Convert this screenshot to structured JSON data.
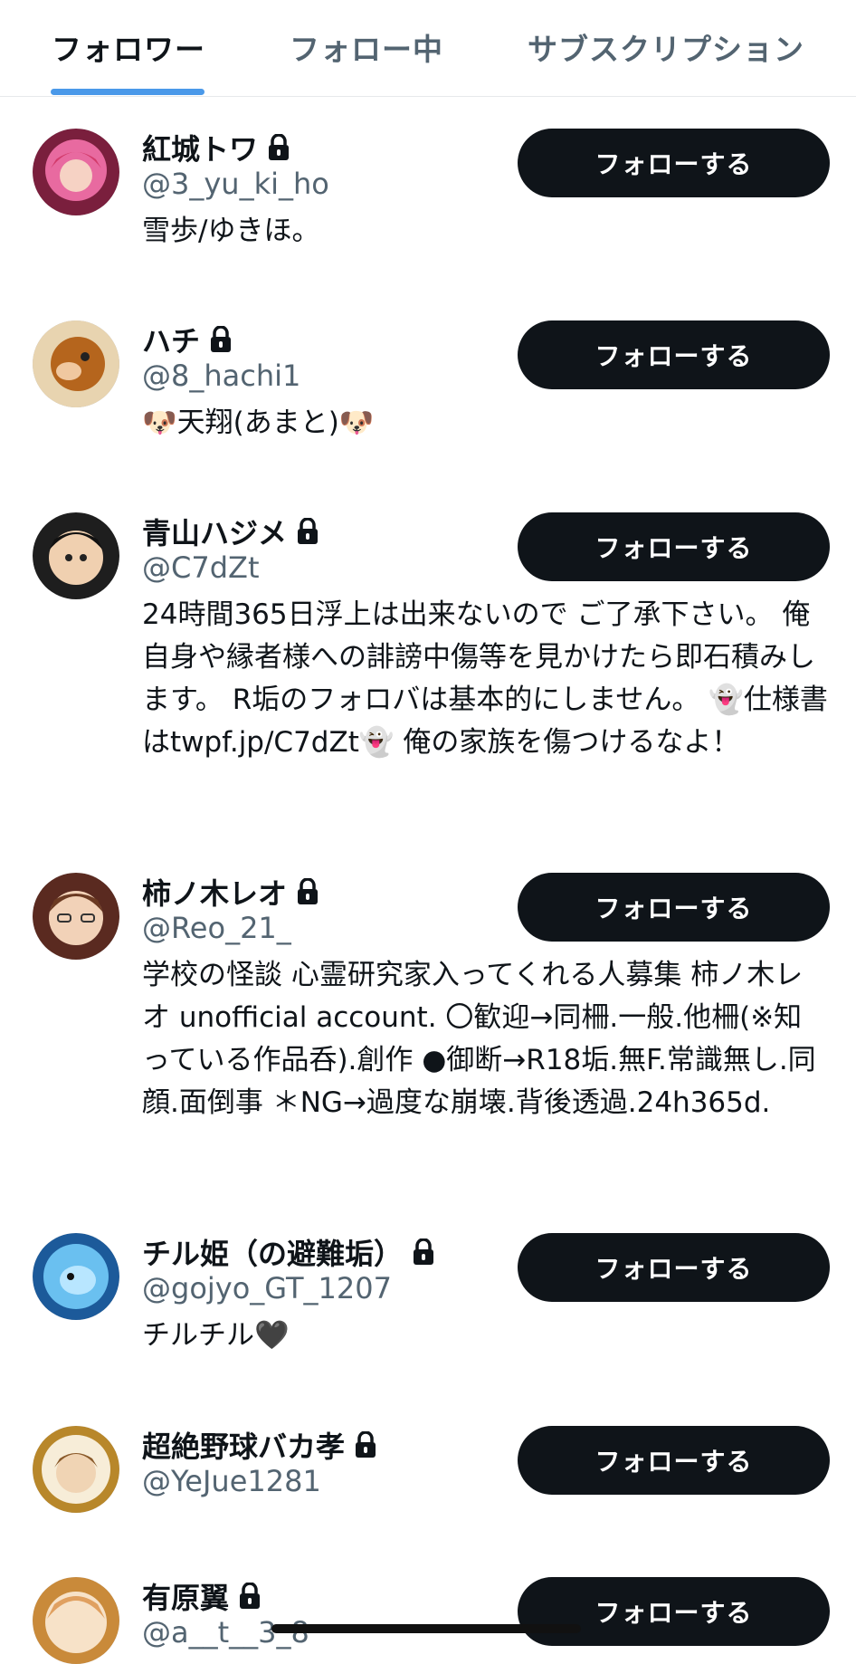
{
  "tabs": [
    {
      "label": "フォロワー",
      "active": true
    },
    {
      "label": "フォロー中",
      "active": false
    },
    {
      "label": "サブスクリプション",
      "active": false
    }
  ],
  "follow_label": "フォローする",
  "accent_color": "#4a99e9",
  "users": [
    {
      "name": "紅城トワ",
      "handle": "@3_yu_ki_ho",
      "bio": "雪歩/ゆきほ。",
      "protected": true,
      "avatar_color": "#d23a6a"
    },
    {
      "name": "ハチ",
      "handle": "@8_hachi1",
      "bio": "🐶天翔(あまと)🐶",
      "protected": true,
      "avatar_color": "#b5651d"
    },
    {
      "name": "青山ハジメ",
      "handle": "@C7dZt",
      "bio": "24時間365日浮上は出来ないので ご了承下さい。 俺自身や縁者様への誹謗中傷等を見かけたら即石積みします。 R垢のフォロバは基本的にしません。 👻仕様書はtwpf.jp/C7dZt👻 俺の家族を傷つけるなよ！",
      "protected": true,
      "avatar_color": "#2b2b2b"
    },
    {
      "name": "柿ノ木レオ",
      "handle": "@Reo_21_",
      "bio": "学校の怪談 心霊研究家入ってくれる人募集 柿ノ木レオ unofficial account. 〇歓迎→同柵.一般.他柵(※知っている作品呑).創作 ●御断→R18垢.無F.常識無し.同顔.面倒事 ＊NG→過度な崩壊.背後透過.24h365d.",
      "protected": true,
      "avatar_color": "#7a3b2e"
    },
    {
      "name": "チル姫（の避難垢）",
      "handle": "@gojyo_GT_1207",
      "bio": "チルチル🖤",
      "protected": true,
      "avatar_color": "#3a8fd0"
    },
    {
      "name": "超絶野球バカ孝",
      "handle": "@YeJue1281",
      "bio": "",
      "protected": true,
      "avatar_color": "#c9a24a"
    },
    {
      "name": "有原翼",
      "handle": "@a__t__3_8",
      "bio": "",
      "protected": true,
      "avatar_color": "#e0a060"
    }
  ]
}
